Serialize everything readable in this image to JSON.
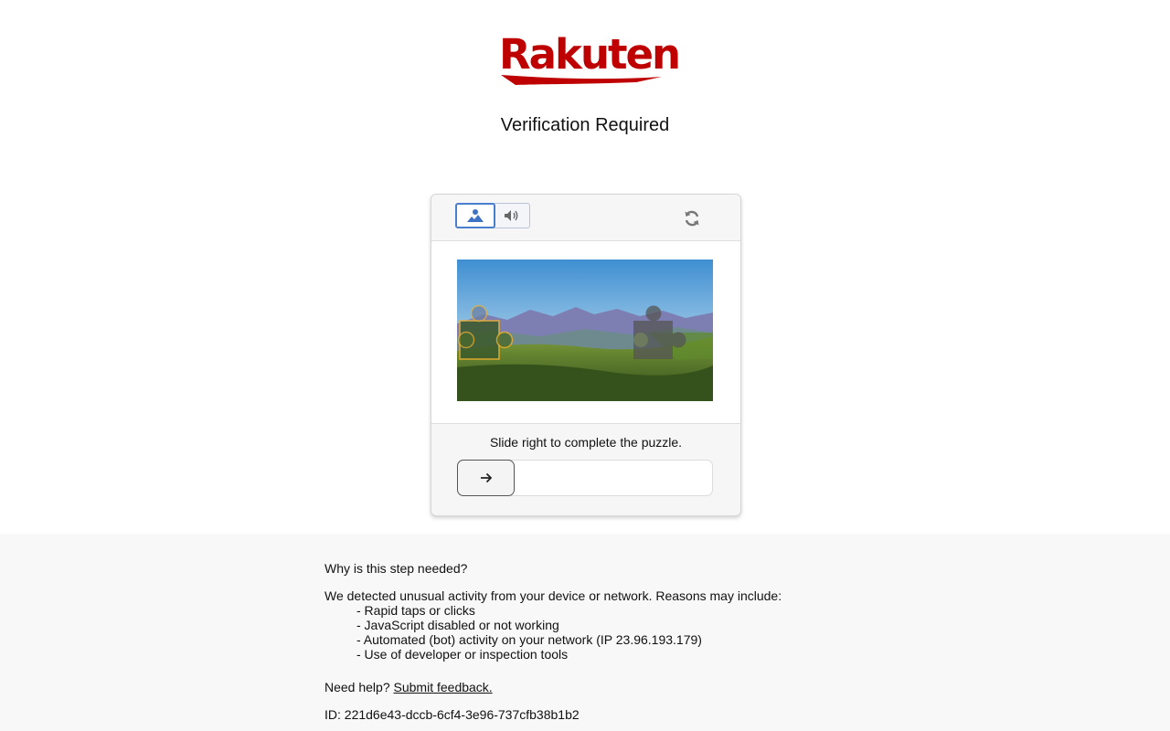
{
  "brand": {
    "logo_text": "Rakuten",
    "logo_color": "#bf0000"
  },
  "page": {
    "title": "Verification Required"
  },
  "captcha": {
    "mode_buttons": [
      {
        "icon": "image-icon",
        "active": true
      },
      {
        "icon": "speaker-icon",
        "active": false
      }
    ],
    "refresh_icon": "refresh-icon",
    "image_description_icon": "mountain-landscape-puzzle",
    "instruction": "Slide right to complete the puzzle.",
    "slider_icon": "arrow-right-icon",
    "slider_progress": 0,
    "accent_color": "#4a7fcf",
    "piece_outline_color": "#f0b030"
  },
  "info": {
    "question": "Why is this step needed?",
    "detected": "We detected unusual activity from your device or network. Reasons may include:",
    "reasons": [
      "- Rapid taps or clicks",
      "- JavaScript disabled or not working",
      "- Automated (bot) activity on your network (IP 23.96.193.179)",
      "- Use of developer or inspection tools"
    ],
    "help_prefix": "Need help? ",
    "help_link": "Submit feedback.",
    "id_line": "ID: 221d6e43-dccb-6cf4-3e96-737cfb38b1b2"
  }
}
